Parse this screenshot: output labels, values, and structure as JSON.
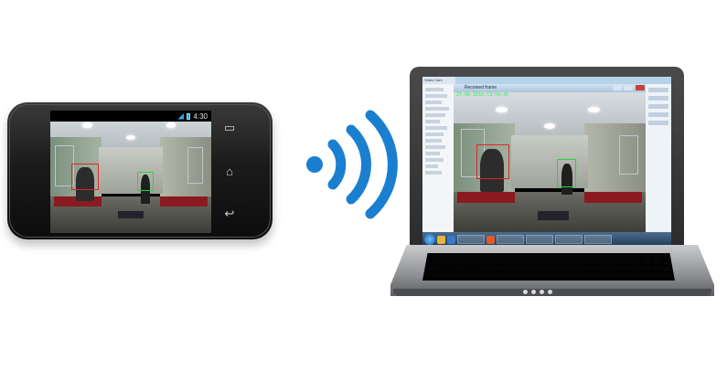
{
  "phone": {
    "status_time": "4:30",
    "nav_icons": [
      "recent-apps-icon",
      "home-icon",
      "back-icon"
    ]
  },
  "wireless": {
    "icon": "wifi-signal-icon",
    "color": "#1b7fd0"
  },
  "laptop": {
    "window_title": "Received frame",
    "timestamp": "27-08-2016:13:59:45",
    "left_panel_title": "Video Cam",
    "taskbar_buttons": [
      "",
      "",
      "",
      "",
      "",
      ""
    ]
  },
  "colors": {
    "detection_red": "#e0262a",
    "detection_green": "#22d83a",
    "wifi_blue": "#1b7fd0"
  }
}
